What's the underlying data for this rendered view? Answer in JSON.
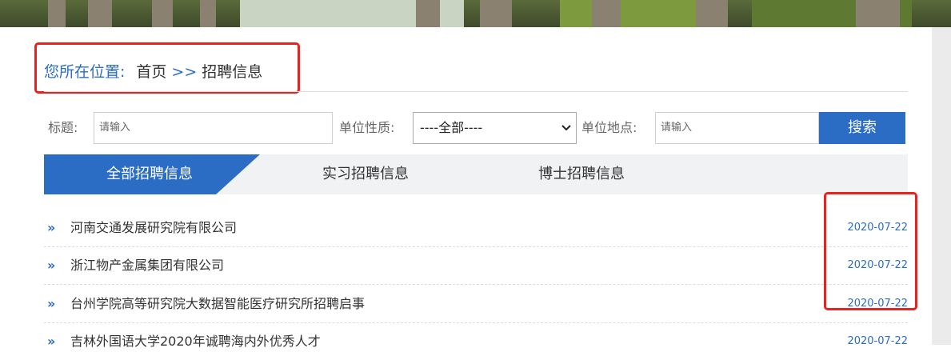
{
  "breadcrumb": {
    "label": "您所在位置:",
    "home": "首页",
    "separator": ">>",
    "current": "招聘信息"
  },
  "filters": {
    "title_label": "标题:",
    "title_placeholder": "请输入",
    "type_label": "单位性质:",
    "type_value": "----全部----",
    "location_label": "单位地点:",
    "location_placeholder": "请输入",
    "search_button": "搜索"
  },
  "tabs": [
    {
      "label": "全部招聘信息",
      "active": true
    },
    {
      "label": "实习招聘信息",
      "active": false
    },
    {
      "label": "博士招聘信息",
      "active": false
    }
  ],
  "list": [
    {
      "title": "河南交通发展研究院有限公司",
      "date": "2020-07-22"
    },
    {
      "title": "浙江物产金属集团有限公司",
      "date": "2020-07-22"
    },
    {
      "title": "台州学院高等研究院大数据智能医疗研究所招聘启事",
      "date": "2020-07-22"
    },
    {
      "title": "吉林外国语大学2020年诚聘海内外优秀人才",
      "date": "2020-07-22"
    }
  ],
  "colors": {
    "accent": "#2b6cc4",
    "highlight": "#e8231f"
  },
  "icons": {
    "list_bullet": "double-chevron-right-icon",
    "select_arrow": "chevron-down-icon"
  }
}
